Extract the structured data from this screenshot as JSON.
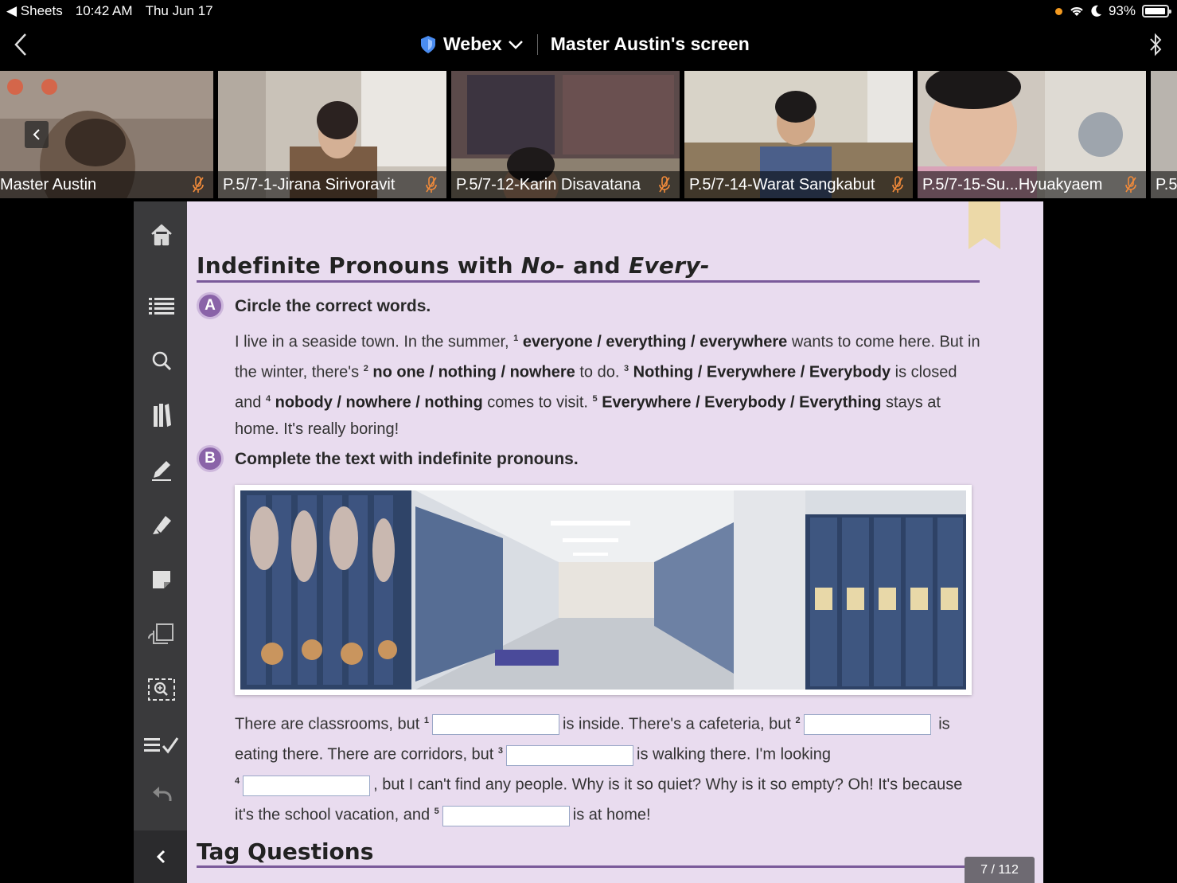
{
  "status_bar": {
    "back_app": "◀ Sheets",
    "time": "10:42 AM",
    "date": "Thu Jun 17",
    "battery": "93%"
  },
  "title_bar": {
    "app_name": "Webex",
    "screen_title": "Master Austin's screen"
  },
  "participants": [
    {
      "name": "Master Austin"
    },
    {
      "name": "P.5/7-1-Jirana Sirivoravit"
    },
    {
      "name": "P.5/7-12-Karin Disavatana"
    },
    {
      "name": "P.5/7-14-Warat Sangkabut"
    },
    {
      "name": "P.5/7-15-Su...Hyuakyaem"
    },
    {
      "name": "P.5"
    }
  ],
  "page": {
    "heading_part1": "Indefinite Pronouns with ",
    "heading_no": "No-",
    "heading_and": " and ",
    "heading_every": "Every-",
    "section_a": {
      "badge": "A",
      "instruction": "Circle the correct words.",
      "p1": "I live in a seaside town. In the summer, ",
      "n1": "1",
      "o1": "everyone / everything / everywhere",
      "p2": " wants to come here. But in the winter, there's ",
      "n2": "2",
      "o2": "no one / nothing / nowhere",
      "p3": " to do. ",
      "n3": "3",
      "o3": "Nothing / Everywhere / Everybody",
      "p4": " is closed and ",
      "n4": "4",
      "o4": "nobody / nowhere / nothing",
      "p5": " comes to visit. ",
      "n5": "5",
      "o5": "Everywhere / Everybody / Everything",
      "p6": " stays at home. It's really boring!"
    },
    "section_b": {
      "badge": "B",
      "instruction": "Complete the text with indefinite pronouns.",
      "t1": "There are classrooms, but ",
      "n1": "1",
      "t2": "is inside. There's a cafeteria, but ",
      "n2": "2",
      "t3": "is eating there. There are corridors, but ",
      "n3": "3",
      "t4": "is walking there. I'm looking ",
      "n4": "4",
      "t5": ", but I can't find any people. Why is it so quiet? Why is it so empty? Oh! It's because it's the school vacation, and ",
      "n5": "5",
      "t6": "is at home!"
    },
    "heading2": "Tag Questions",
    "page_indicator": "7 / 112"
  },
  "colors": {
    "page_bg": "#e9dcef",
    "accent_purple": "#8a63a8",
    "toolbar_bg": "#3a3a3c"
  }
}
